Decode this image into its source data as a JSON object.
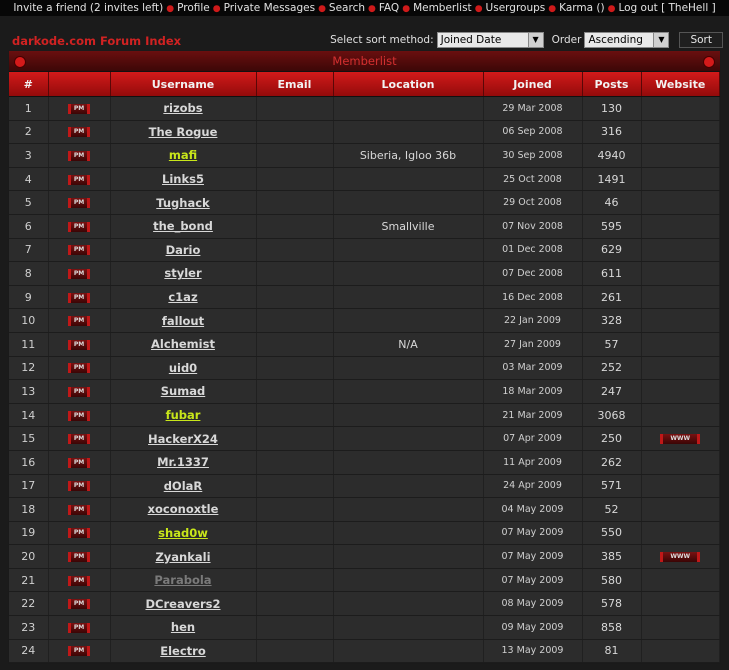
{
  "topbar": {
    "items": [
      "Invite a friend (2 invites left)",
      "Profile",
      "Private Messages",
      "Search",
      "FAQ",
      "Memberlist",
      "Usergroups",
      "Karma ()",
      "Log out [ TheHell ]"
    ]
  },
  "header": {
    "index_link": "darkode.com Forum Index",
    "sort_label": "Select sort method:",
    "sort_value": "Joined Date",
    "order_label": "Order",
    "order_value": "Ascending",
    "sort_button": "Sort"
  },
  "table": {
    "title": "Memberlist",
    "columns": [
      "#",
      "",
      "Username",
      "Email",
      "Location",
      "Joined",
      "Posts",
      "Website"
    ],
    "pm_label": "PM",
    "www_label": "WWW",
    "rows": [
      {
        "n": "1",
        "user": "rizobs",
        "style": "normal",
        "loc": "",
        "joined": "29 Mar 2008",
        "posts": "130",
        "www": false
      },
      {
        "n": "2",
        "user": "The Rogue",
        "style": "normal",
        "loc": "",
        "joined": "06 Sep 2008",
        "posts": "316",
        "www": false
      },
      {
        "n": "3",
        "user": "mafi",
        "style": "yellow",
        "loc": "Siberia, Igloo 36b",
        "joined": "30 Sep 2008",
        "posts": "4940",
        "www": false
      },
      {
        "n": "4",
        "user": "Links5",
        "style": "normal",
        "loc": "",
        "joined": "25 Oct 2008",
        "posts": "1491",
        "www": false
      },
      {
        "n": "5",
        "user": "Tughack",
        "style": "normal",
        "loc": "",
        "joined": "29 Oct 2008",
        "posts": "46",
        "www": false
      },
      {
        "n": "6",
        "user": "the_bond",
        "style": "normal",
        "loc": "Smallville",
        "joined": "07 Nov 2008",
        "posts": "595",
        "www": false
      },
      {
        "n": "7",
        "user": "Dario",
        "style": "normal",
        "loc": "",
        "joined": "01 Dec 2008",
        "posts": "629",
        "www": false
      },
      {
        "n": "8",
        "user": "styler",
        "style": "normal",
        "loc": "",
        "joined": "07 Dec 2008",
        "posts": "611",
        "www": false
      },
      {
        "n": "9",
        "user": "c1az",
        "style": "normal",
        "loc": "",
        "joined": "16 Dec 2008",
        "posts": "261",
        "www": false
      },
      {
        "n": "10",
        "user": "fallout",
        "style": "normal",
        "loc": "",
        "joined": "22 Jan 2009",
        "posts": "328",
        "www": false
      },
      {
        "n": "11",
        "user": "Alchemist",
        "style": "normal",
        "loc": "N/A",
        "joined": "27 Jan 2009",
        "posts": "57",
        "www": false
      },
      {
        "n": "12",
        "user": "uid0",
        "style": "normal",
        "loc": "",
        "joined": "03 Mar 2009",
        "posts": "252",
        "www": false
      },
      {
        "n": "13",
        "user": "Sumad",
        "style": "normal",
        "loc": "",
        "joined": "18 Mar 2009",
        "posts": "247",
        "www": false
      },
      {
        "n": "14",
        "user": "fubar",
        "style": "yellow",
        "loc": "",
        "joined": "21 Mar 2009",
        "posts": "3068",
        "www": false
      },
      {
        "n": "15",
        "user": "HackerX24",
        "style": "normal",
        "loc": "",
        "joined": "07 Apr 2009",
        "posts": "250",
        "www": true
      },
      {
        "n": "16",
        "user": "Mr.1337",
        "style": "normal",
        "loc": "",
        "joined": "11 Apr 2009",
        "posts": "262",
        "www": false
      },
      {
        "n": "17",
        "user": "dOlaR",
        "style": "normal",
        "loc": "",
        "joined": "24 Apr 2009",
        "posts": "571",
        "www": false
      },
      {
        "n": "18",
        "user": "xoconoxtle",
        "style": "normal",
        "loc": "",
        "joined": "04 May 2009",
        "posts": "52",
        "www": false
      },
      {
        "n": "19",
        "user": "shad0w",
        "style": "yellow",
        "loc": "",
        "joined": "07 May 2009",
        "posts": "550",
        "www": false
      },
      {
        "n": "20",
        "user": "Zyankali",
        "style": "normal",
        "loc": "",
        "joined": "07 May 2009",
        "posts": "385",
        "www": true
      },
      {
        "n": "21",
        "user": "Parabola",
        "style": "grey",
        "loc": "",
        "joined": "07 May 2009",
        "posts": "580",
        "www": false
      },
      {
        "n": "22",
        "user": "DCreavers2",
        "style": "normal",
        "loc": "",
        "joined": "08 May 2009",
        "posts": "578",
        "www": false
      },
      {
        "n": "23",
        "user": "hen",
        "style": "normal",
        "loc": "",
        "joined": "09 May 2009",
        "posts": "858",
        "www": false
      },
      {
        "n": "24",
        "user": "Electro",
        "style": "normal",
        "loc": "",
        "joined": "13 May 2009",
        "posts": "81",
        "www": false
      }
    ]
  }
}
